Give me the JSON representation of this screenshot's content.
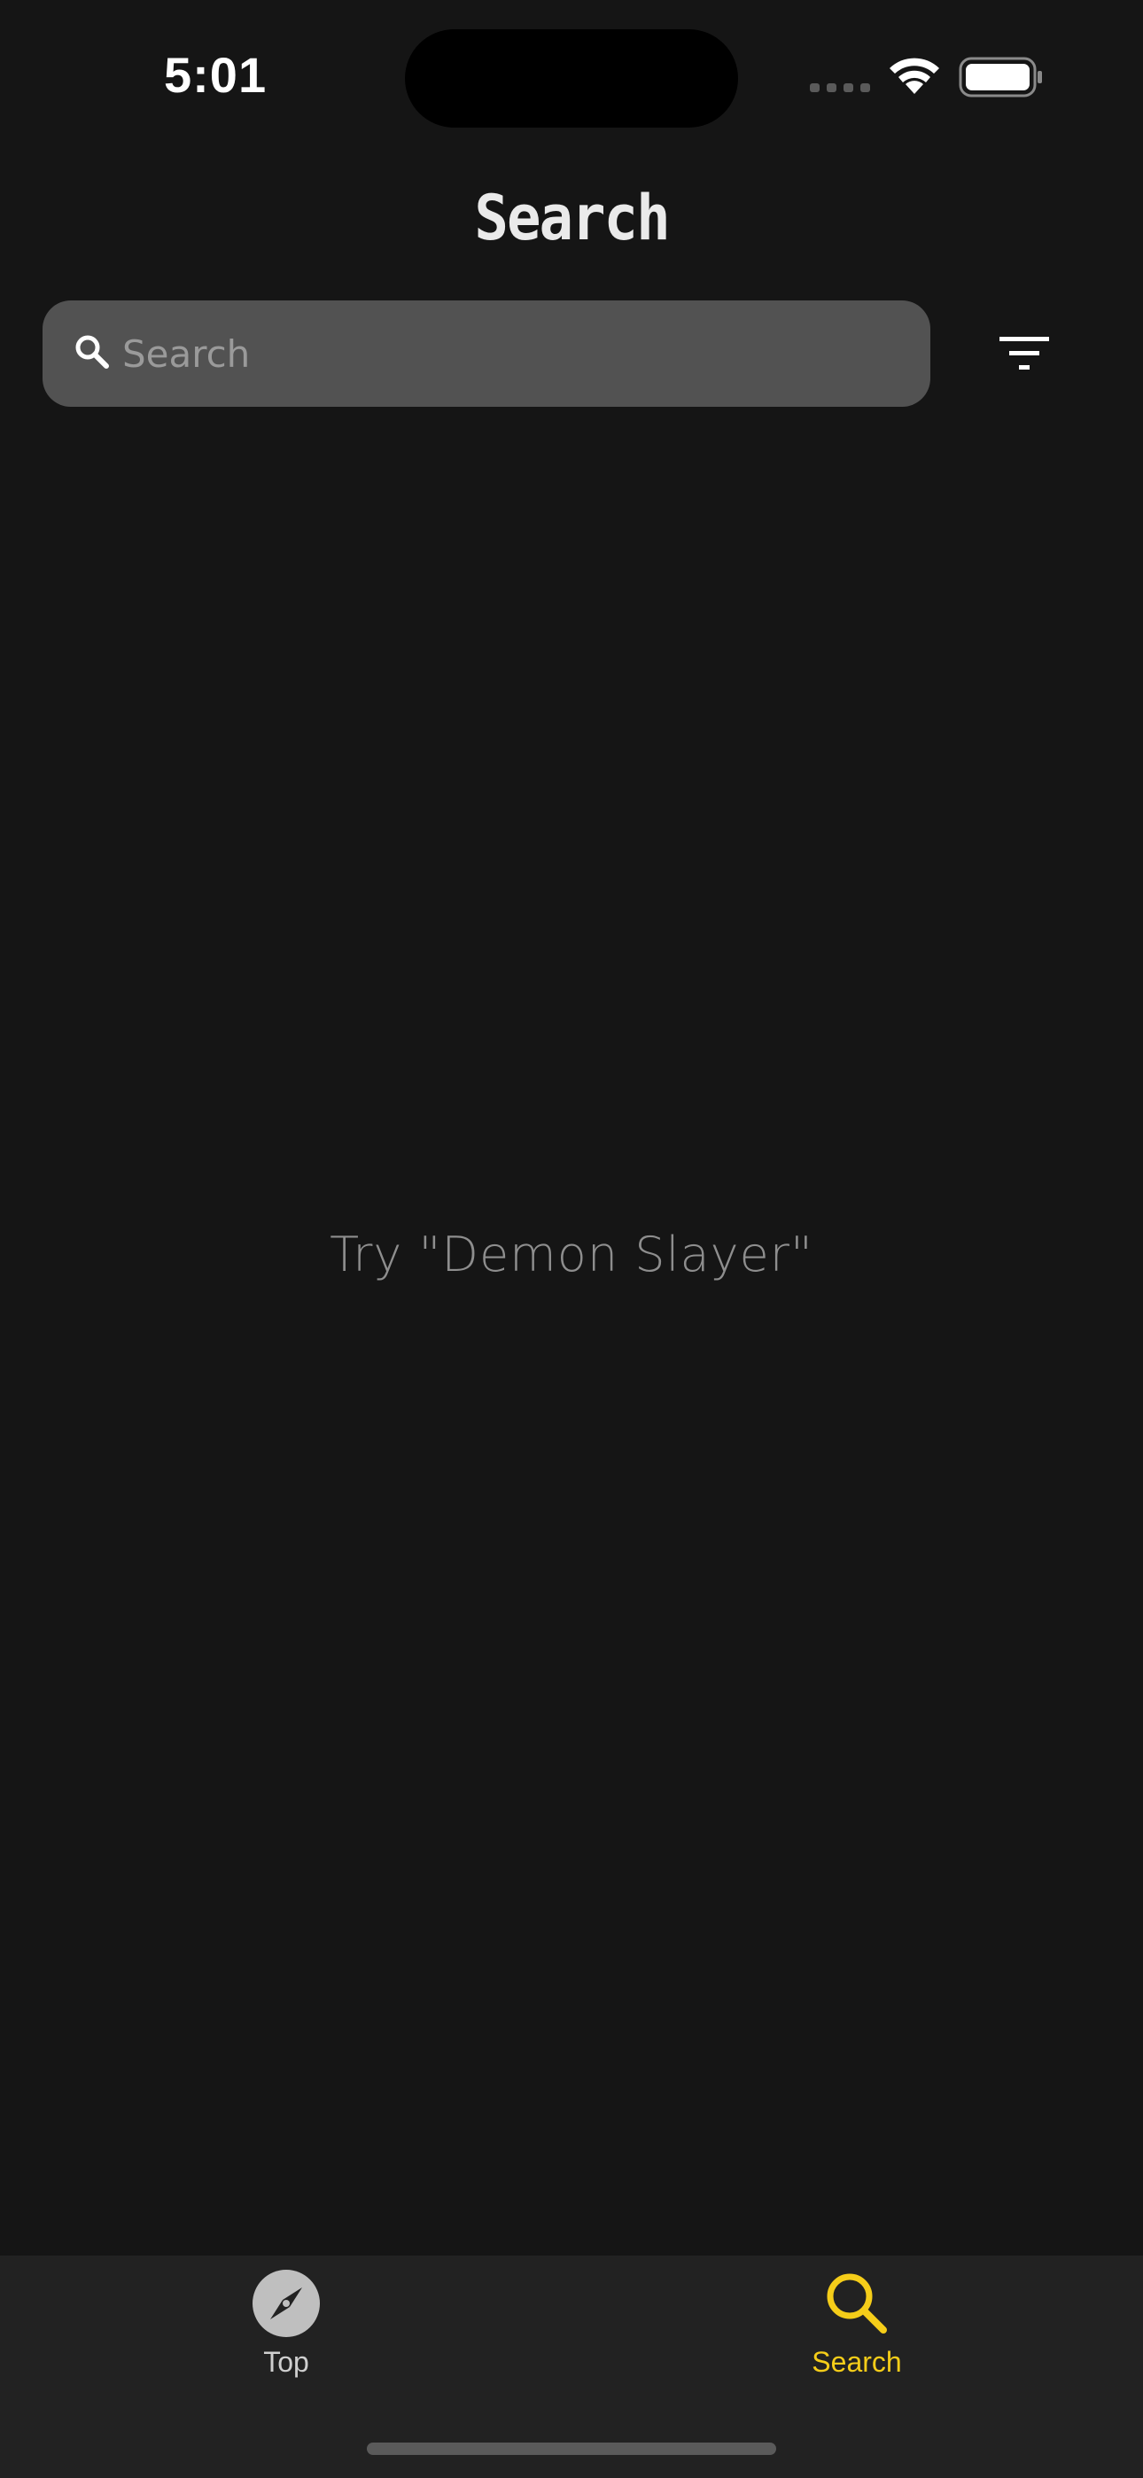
{
  "status_bar": {
    "time": "5:01",
    "icons": [
      "cellular-signal-icon",
      "wifi-icon",
      "battery-icon"
    ]
  },
  "header": {
    "title": "Search"
  },
  "search": {
    "placeholder": "Search",
    "value": "",
    "icon": "search-icon"
  },
  "filter": {
    "icon": "filter-icon"
  },
  "content": {
    "hint": "Try \"Demon Slayer\""
  },
  "tab_bar": {
    "tabs": [
      {
        "label": "Top",
        "icon": "compass-icon",
        "selected": false
      },
      {
        "label": "Search",
        "icon": "search-icon",
        "selected": true
      }
    ]
  },
  "colors": {
    "background": "#151515",
    "search_field": "#525252",
    "tab_bar": "#222222",
    "accent": "#F5CD19",
    "hint_text": "#8E8E8E"
  }
}
